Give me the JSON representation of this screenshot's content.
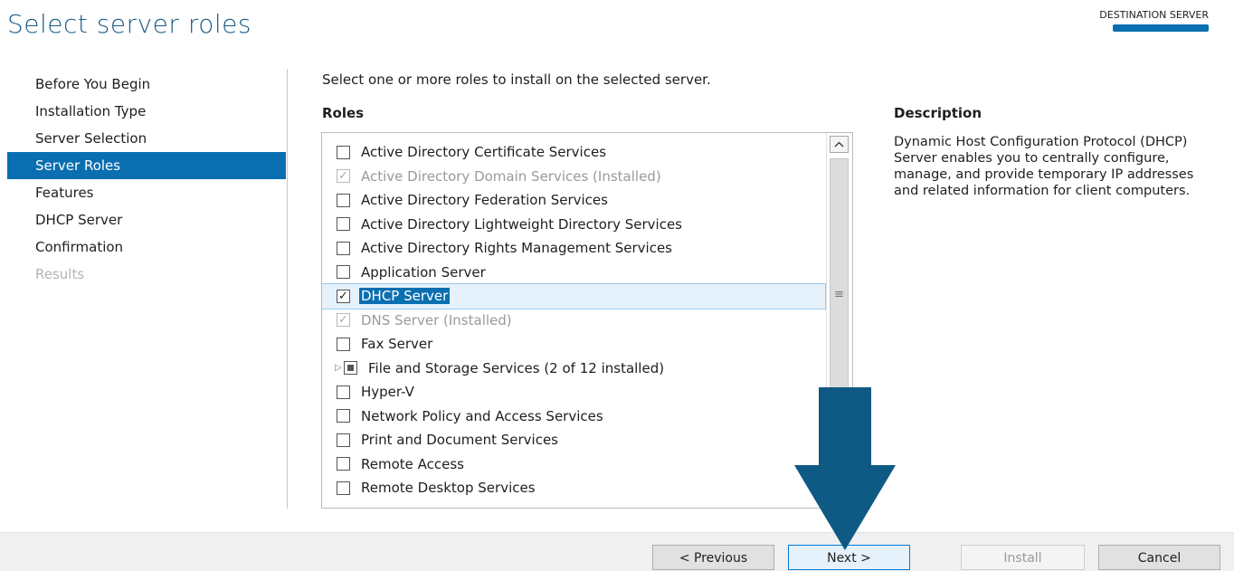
{
  "header": {
    "title": "Select server roles",
    "destination_label": "DESTINATION SERVER"
  },
  "sidebar": {
    "items": [
      {
        "label": "Before You Begin",
        "state": "normal"
      },
      {
        "label": "Installation Type",
        "state": "normal"
      },
      {
        "label": "Server Selection",
        "state": "normal"
      },
      {
        "label": "Server Roles",
        "state": "active"
      },
      {
        "label": "Features",
        "state": "normal"
      },
      {
        "label": "DHCP Server",
        "state": "normal"
      },
      {
        "label": "Confirmation",
        "state": "normal"
      },
      {
        "label": "Results",
        "state": "disabled"
      }
    ]
  },
  "main": {
    "instruction": "Select one or more roles to install on the selected server.",
    "roles_heading": "Roles",
    "roles": [
      {
        "label": "Active Directory Certificate Services",
        "checked": false,
        "disabled": false
      },
      {
        "label": "Active Directory Domain Services (Installed)",
        "checked": true,
        "disabled": true
      },
      {
        "label": "Active Directory Federation Services",
        "checked": false,
        "disabled": false
      },
      {
        "label": "Active Directory Lightweight Directory Services",
        "checked": false,
        "disabled": false
      },
      {
        "label": "Active Directory Rights Management Services",
        "checked": false,
        "disabled": false
      },
      {
        "label": "Application Server",
        "checked": false,
        "disabled": false
      },
      {
        "label": "DHCP Server",
        "checked": true,
        "disabled": false,
        "selected": true
      },
      {
        "label": "DNS Server (Installed)",
        "checked": true,
        "disabled": true
      },
      {
        "label": "Fax Server",
        "checked": false,
        "disabled": false
      },
      {
        "label": "File and Storage Services (2 of 12 installed)",
        "checked": "partial",
        "disabled": false,
        "expandable": true
      },
      {
        "label": "Hyper-V",
        "checked": false,
        "disabled": false
      },
      {
        "label": "Network Policy and Access Services",
        "checked": false,
        "disabled": false
      },
      {
        "label": "Print and Document Services",
        "checked": false,
        "disabled": false
      },
      {
        "label": "Remote Access",
        "checked": false,
        "disabled": false
      },
      {
        "label": "Remote Desktop Services",
        "checked": false,
        "disabled": false
      }
    ]
  },
  "description": {
    "heading": "Description",
    "text": "Dynamic Host Configuration Protocol (DHCP) Server enables you to centrally configure, manage, and provide temporary IP addresses and related information for client computers."
  },
  "footer": {
    "previous_label": "< Previous",
    "next_label": "Next >",
    "install_label": "Install",
    "cancel_label": "Cancel"
  },
  "colors": {
    "accent": "#0a6fb0",
    "title": "#1c5c85",
    "arrow": "#0e5a84"
  }
}
